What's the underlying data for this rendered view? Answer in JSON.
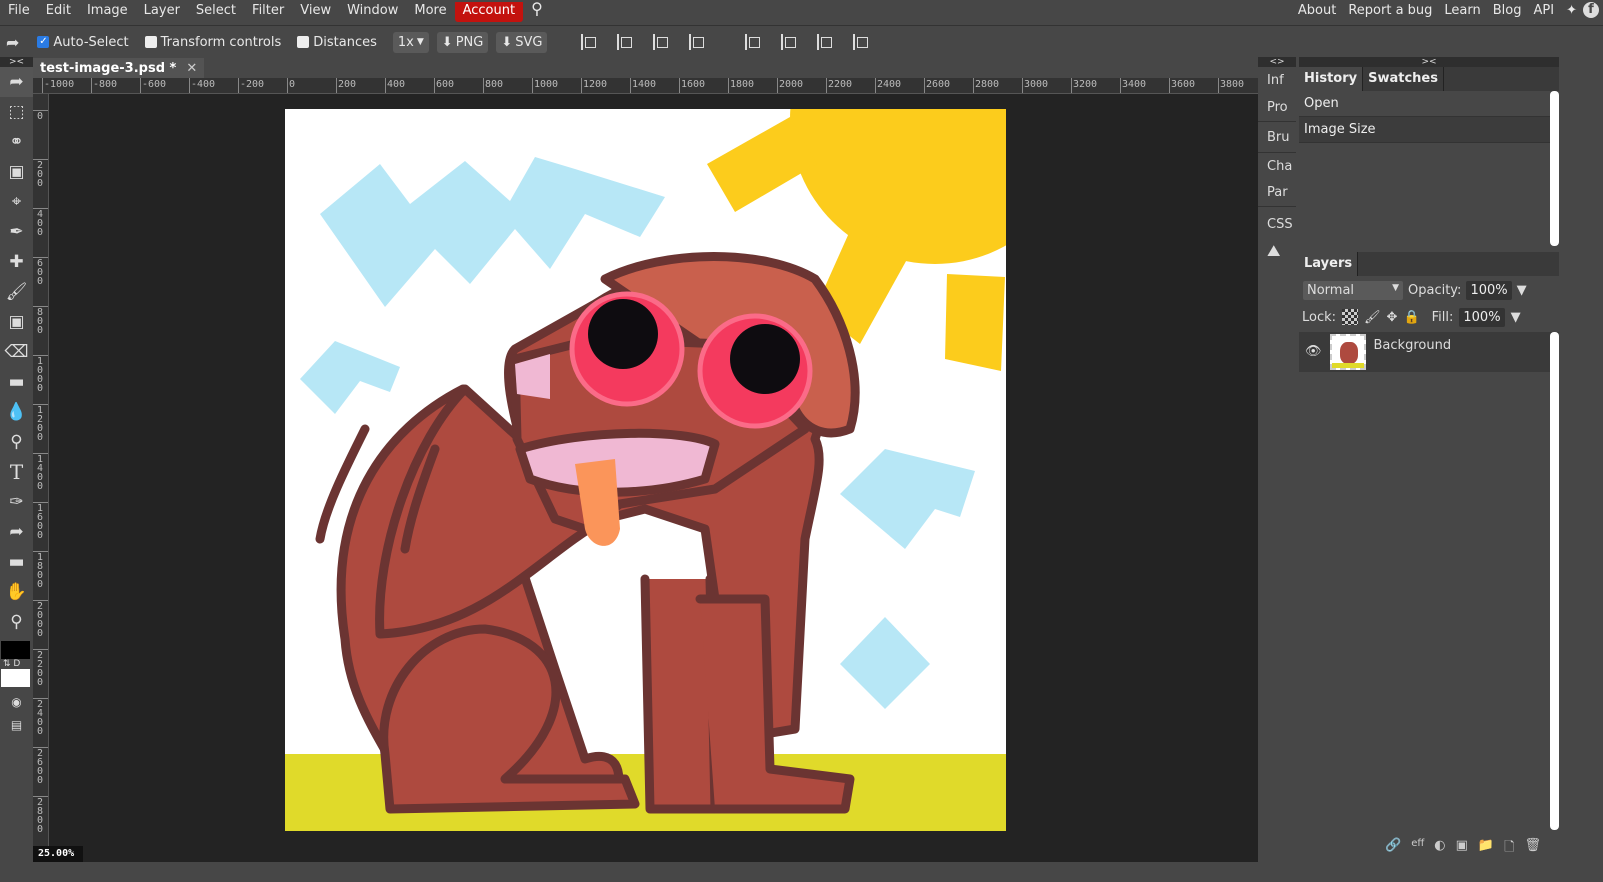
{
  "menu": {
    "items": [
      "File",
      "Edit",
      "Image",
      "Layer",
      "Select",
      "Filter",
      "View",
      "Window",
      "More"
    ],
    "account": "Account",
    "right": [
      "About",
      "Report a bug",
      "Learn",
      "Blog",
      "API"
    ]
  },
  "options": {
    "auto_select": "Auto-Select",
    "auto_select_checked": true,
    "transform_controls": "Transform controls",
    "transform_checked": false,
    "distances": "Distances",
    "distances_checked": false,
    "scale": "1x",
    "png": "PNG",
    "svg": "SVG"
  },
  "document": {
    "tab_title": "test-image-3.psd *",
    "zoom": "25.00%"
  },
  "rulers": {
    "h": [
      "-1000",
      "-800",
      "-600",
      "-400",
      "-200",
      "0",
      "200",
      "400",
      "600",
      "800",
      "1000",
      "1200",
      "1400",
      "1600",
      "1800",
      "2000",
      "2200",
      "2400",
      "2600",
      "2800",
      "3000",
      "3200",
      "3400",
      "3600",
      "3800"
    ],
    "v": [
      "0",
      "200",
      "400",
      "600",
      "800",
      "1000",
      "1200",
      "1400",
      "1600",
      "1800",
      "2000",
      "2200",
      "2400",
      "2600",
      "2800"
    ]
  },
  "side_panels": [
    "Inf",
    "Pro",
    "Bru",
    "Cha",
    "Par",
    "CSS"
  ],
  "history": {
    "tabs": [
      "History",
      "Swatches"
    ],
    "items": [
      "Open",
      "Image Size"
    ]
  },
  "layers": {
    "tab": "Layers",
    "blend_mode": "Normal",
    "opacity_label": "Opacity:",
    "opacity": "100%",
    "lock_label": "Lock:",
    "fill_label": "Fill:",
    "fill": "100%",
    "items": [
      {
        "name": "Background",
        "visible": true
      }
    ]
  },
  "colors": {
    "accent": "#c3120e",
    "foreground": "#000000",
    "background": "#ffffff"
  }
}
